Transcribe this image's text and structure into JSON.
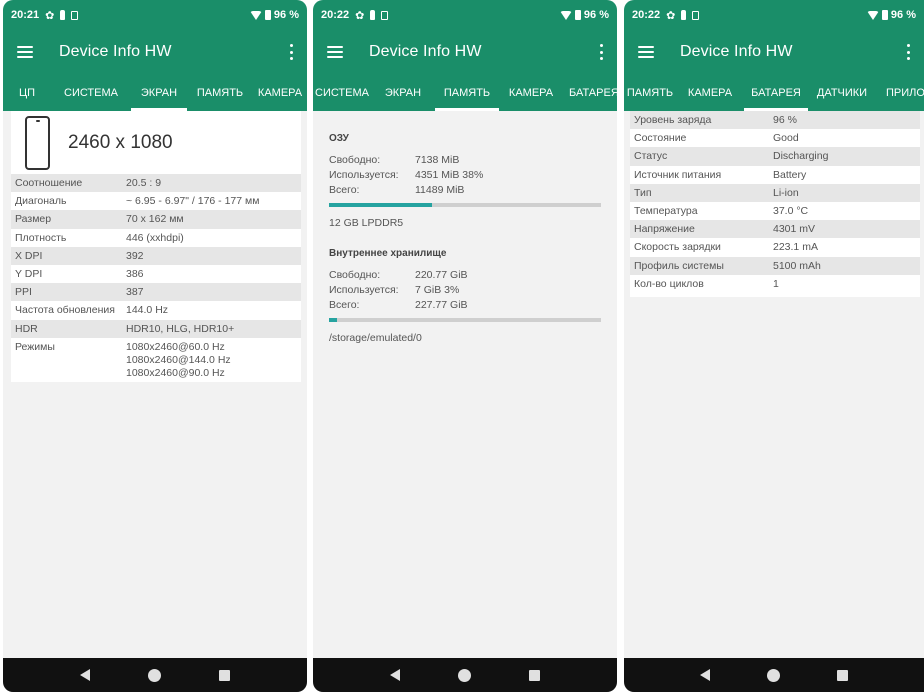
{
  "app": {
    "title": "Device Info HW"
  },
  "screens": [
    {
      "status": {
        "time": "20:21",
        "battery": "96 %"
      },
      "tabs": [
        "ЦП",
        "СИСТЕМА",
        "ЭКРАН",
        "ПАМЯТЬ",
        "КАМЕРА"
      ],
      "active_tab": "ЭКРАН",
      "resolution": "2460 x 1080",
      "rows": [
        {
          "key": "Соотношение",
          "value": "20.5 : 9"
        },
        {
          "key": "Диагональ",
          "value": "~ 6.95 - 6.97\" / 176 - 177 мм"
        },
        {
          "key": "Размер",
          "value": "70 x 162 мм"
        },
        {
          "key": "Плотность",
          "value": "446 (xxhdpi)"
        },
        {
          "key": "X DPI",
          "value": "392"
        },
        {
          "key": "Y DPI",
          "value": "386"
        },
        {
          "key": "PPI",
          "value": "387"
        },
        {
          "key": "Частота обновления",
          "value": "144.0 Hz"
        },
        {
          "key": "HDR",
          "value": "HDR10, HLG, HDR10+"
        }
      ],
      "modes": {
        "key": "Режимы",
        "values": [
          "1080x2460@60.0 Hz",
          "1080x2460@144.0 Hz",
          "1080x2460@90.0 Hz"
        ]
      }
    },
    {
      "status": {
        "time": "20:22",
        "battery": "96 %"
      },
      "tabs": [
        "СИСТЕМА",
        "ЭКРАН",
        "ПАМЯТЬ",
        "КАМЕРА",
        "БАТАРЕЯ"
      ],
      "active_tab": "ПАМЯТЬ",
      "ram": {
        "title": "ОЗУ",
        "rows": [
          {
            "key": "Свободно:",
            "value": "7138 MiB"
          },
          {
            "key": "Используется:",
            "value": "4351 MiB 38%"
          },
          {
            "key": "Всего:",
            "value": "11489 MiB"
          }
        ],
        "used_fraction": 0.38,
        "footer": "12 GB LPDDR5"
      },
      "storage": {
        "title": "Внутреннее хранилище",
        "rows": [
          {
            "key": "Свободно:",
            "value": "220.77 GiB"
          },
          {
            "key": "Используется:",
            "value": "7 GiB 3%"
          },
          {
            "key": "Всего:",
            "value": "227.77 GiB"
          }
        ],
        "used_fraction": 0.03,
        "footer": "/storage/emulated/0"
      }
    },
    {
      "status": {
        "time": "20:22",
        "battery": "96 %"
      },
      "tabs": [
        "ПАМЯТЬ",
        "КАМЕРА",
        "БАТАРЕЯ",
        "ДАТЧИКИ",
        "ПРИЛО"
      ],
      "active_tab": "БАТАРЕЯ",
      "rows": [
        {
          "key": "Уровень заряда",
          "value": "96 %"
        },
        {
          "key": "Состояние",
          "value": "Good"
        },
        {
          "key": "Статус",
          "value": "Discharging"
        },
        {
          "key": "Источник питания",
          "value": "Battery"
        },
        {
          "key": "Тип",
          "value": "Li-ion"
        },
        {
          "key": "Температура",
          "value": "37.0 °C"
        },
        {
          "key": "Напряжение",
          "value": "4301 mV"
        },
        {
          "key": "Скорость зарядки",
          "value": "223.1 mA"
        },
        {
          "key": "Профиль системы",
          "value": "5100 mAh"
        },
        {
          "key": "Кол-во циклов",
          "value": "1"
        }
      ]
    }
  ],
  "colors": {
    "primary": "#1a8e69",
    "progress": "#26a3a0",
    "background": "#f2f2f2",
    "nav": "#111111"
  },
  "icons": [
    "menu-icon",
    "more-vert-icon",
    "gear-icon",
    "person-icon",
    "sim-icon",
    "wifi-icon",
    "battery-icon",
    "phone-outline-icon",
    "back-icon",
    "home-icon",
    "recents-icon"
  ]
}
